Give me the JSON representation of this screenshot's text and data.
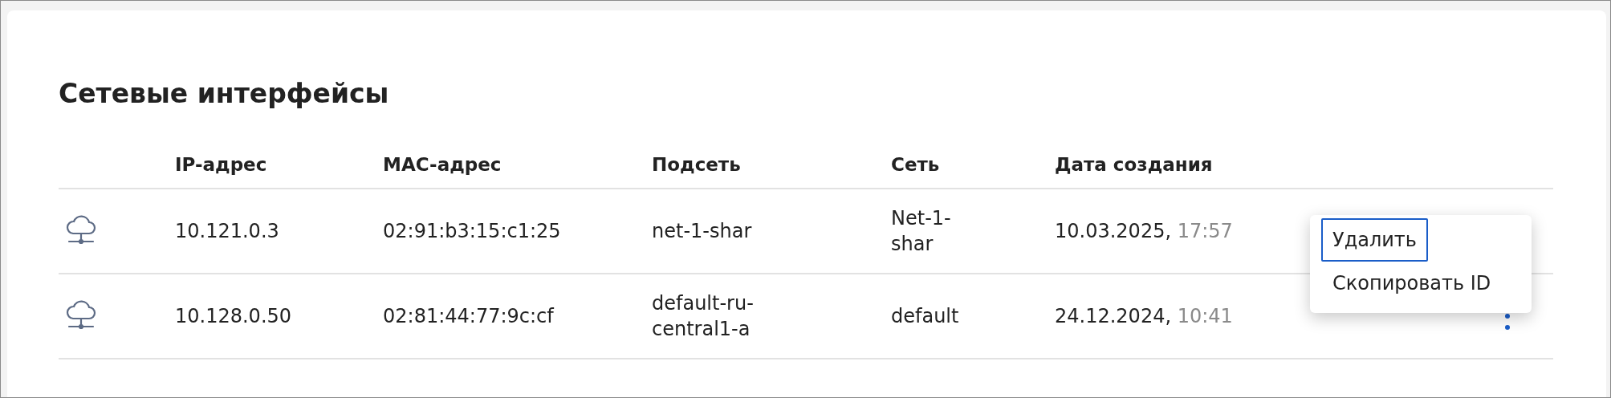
{
  "title": "Сетевые интерфейсы",
  "table": {
    "columns": [
      "IP-адрес",
      "MAC-адрес",
      "Подсеть",
      "Сеть",
      "Дата создания"
    ],
    "rows": [
      {
        "ip": "10.121.0.3",
        "mac": "02:91:b3:15:c1:25",
        "subnet": "net-1-shar",
        "network": "Net-1-shar",
        "date": "10.03.2025,",
        "time": "17:57"
      },
      {
        "ip": "10.128.0.50",
        "mac": "02:81:44:77:9c:cf",
        "subnet": "default-ru-central1-a",
        "network": "default",
        "date": "24.12.2024,",
        "time": "10:41"
      }
    ]
  },
  "context_menu": {
    "items": [
      {
        "label": "Удалить",
        "selected": true
      },
      {
        "label": "Скопировать ID",
        "selected": false
      }
    ]
  }
}
